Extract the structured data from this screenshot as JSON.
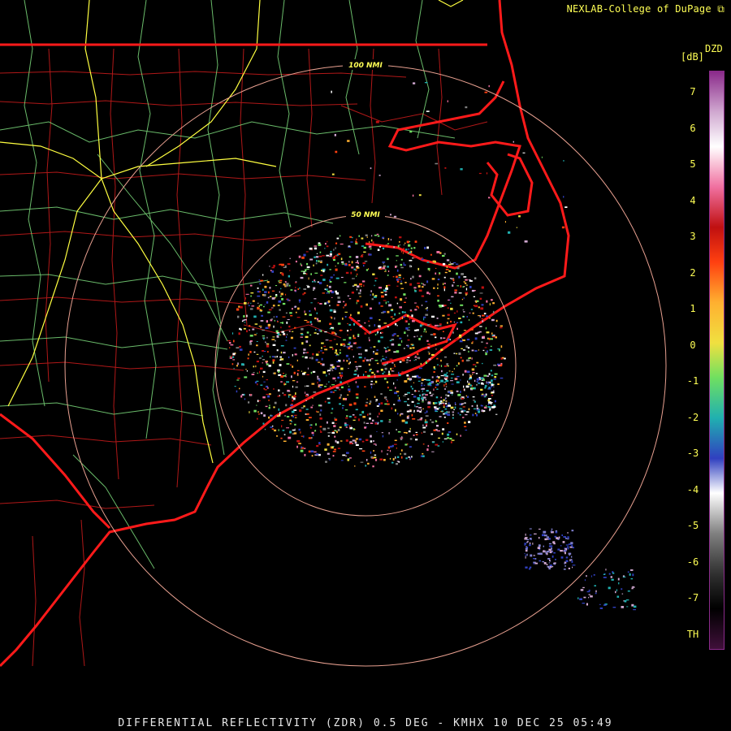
{
  "credit": "NEXLAB-College of DuPage",
  "footer": "DIFFERENTIAL REFLECTIVITY (ZDR) 0.5 DEG - KMHX 10 DEC 25 05:49",
  "range_rings": [
    {
      "label": "50 NMI"
    },
    {
      "label": "100 NMI"
    }
  ],
  "colorbar": {
    "product": "DZD",
    "unit": "[dB]",
    "ticks": [
      "7",
      "6",
      "5",
      "4",
      "3",
      "2",
      "1",
      "0",
      "-1",
      "-2",
      "-3",
      "-4",
      "-5",
      "-6",
      "-7",
      "TH"
    ]
  },
  "colors": {
    "state_borders": "#ff1a1a",
    "county_borders": "#b01818",
    "highways": "#7ddc7d",
    "interstates": "#ffff40",
    "range_rings": "#e8a090",
    "labels": "#ffff55",
    "colorbar_stops": [
      "#8a2a8a",
      "#d0a8d0",
      "#ffffff",
      "#f070a0",
      "#c01010",
      "#ff4010",
      "#ffb030",
      "#f0e040",
      "#70e060",
      "#20b0b0",
      "#3040c0",
      "#ffffff",
      "#808080",
      "#303030",
      "#000000",
      "#40103a"
    ]
  }
}
